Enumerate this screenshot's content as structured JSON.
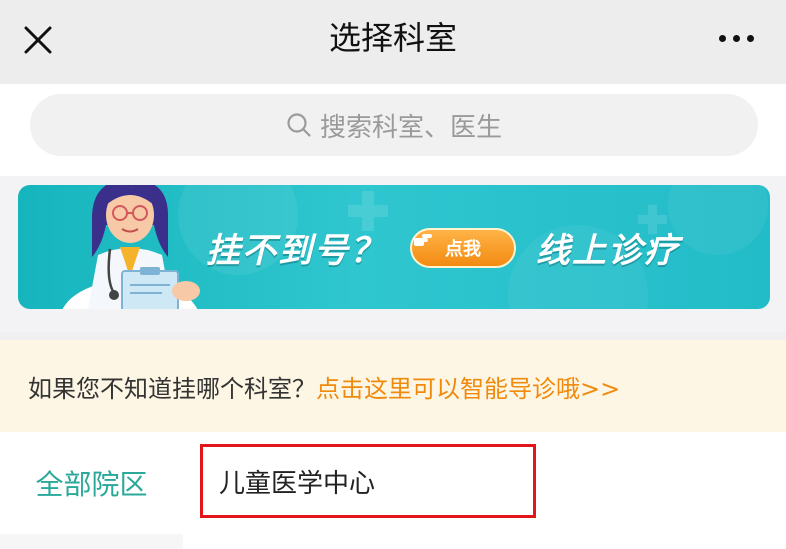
{
  "header": {
    "title": "选择科室"
  },
  "search": {
    "placeholder": "搜索科室、医生"
  },
  "banner": {
    "text_left": "挂不到号？",
    "button_label": "点我",
    "text_right": "线上诊疗"
  },
  "tip": {
    "text": "如果您不知道挂哪个科室？",
    "link": "点击这里可以智能导诊哦>>"
  },
  "sidebar": {
    "items": [
      {
        "label": "全部院区"
      }
    ]
  },
  "departments": [
    {
      "label": "儿童医学中心"
    }
  ],
  "colors": {
    "accent_teal": "#2aa89a",
    "link_orange": "#f08a0c",
    "highlight_red": "#e0161a"
  }
}
